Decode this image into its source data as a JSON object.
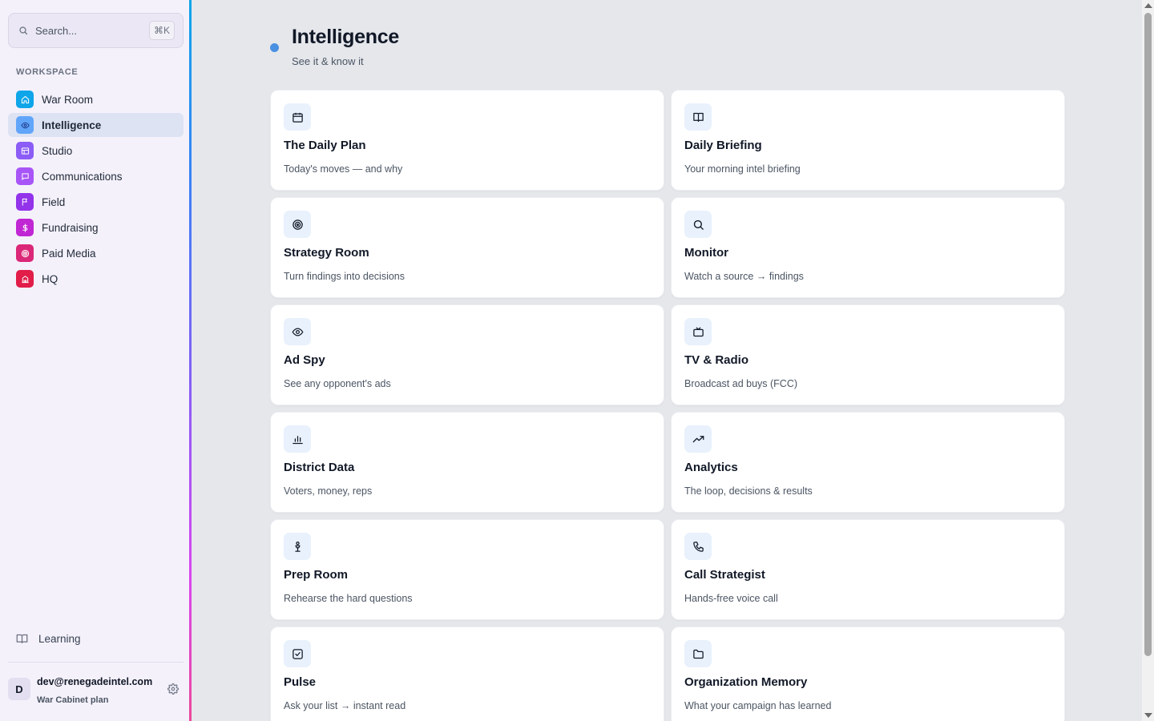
{
  "search": {
    "placeholder": "Search...",
    "shortcut": "⌘K"
  },
  "sidebar": {
    "section_label": "WORKSPACE",
    "items": [
      {
        "label": "War Room",
        "icon": "home-icon",
        "color": "#0ea5e9"
      },
      {
        "label": "Intelligence",
        "icon": "eye-icon",
        "color": "#60a5fa",
        "active": true
      },
      {
        "label": "Studio",
        "icon": "layout-icon",
        "color": "#8b5cf6"
      },
      {
        "label": "Communications",
        "icon": "message-icon",
        "color": "#a855f7"
      },
      {
        "label": "Field",
        "icon": "flag-icon",
        "color": "#9333ea"
      },
      {
        "label": "Fundraising",
        "icon": "dollar-icon",
        "color": "#c026d3"
      },
      {
        "label": "Paid Media",
        "icon": "target-icon",
        "color": "#db2777"
      },
      {
        "label": "HQ",
        "icon": "building-icon",
        "color": "#e11d48"
      }
    ],
    "learning_label": "Learning",
    "user": {
      "initial": "D",
      "email": "dev@renegadeintel.com",
      "plan": "War Cabinet plan"
    }
  },
  "page": {
    "title": "Intelligence",
    "subtitle": "See it & know it",
    "accent_color": "#4a90e2"
  },
  "cards": [
    {
      "title": "The Daily Plan",
      "desc": "Today's moves — and why",
      "icon": "calendar-icon"
    },
    {
      "title": "Daily Briefing",
      "desc": "Your morning intel briefing",
      "icon": "book-icon"
    },
    {
      "title": "Strategy Room",
      "desc": "Turn findings into decisions",
      "icon": "target-icon"
    },
    {
      "title": "Monitor",
      "desc": "Watch a source → findings",
      "icon": "search-icon"
    },
    {
      "title": "Ad Spy",
      "desc": "See any opponent's ads",
      "icon": "eye-icon"
    },
    {
      "title": "TV & Radio",
      "desc": "Broadcast ad buys (FCC)",
      "icon": "tv-icon"
    },
    {
      "title": "District Data",
      "desc": "Voters, money, reps",
      "icon": "bar-chart-icon"
    },
    {
      "title": "Analytics",
      "desc": "The loop, decisions & results",
      "icon": "trending-up-icon"
    },
    {
      "title": "Prep Room",
      "desc": "Rehearse the hard questions",
      "icon": "podium-icon"
    },
    {
      "title": "Call Strategist",
      "desc": "Hands-free voice call",
      "icon": "phone-icon"
    },
    {
      "title": "Pulse",
      "desc": "Ask your list → instant read",
      "icon": "check-square-icon"
    },
    {
      "title": "Organization Memory",
      "desc": "What your campaign has learned",
      "icon": "folder-icon"
    }
  ]
}
